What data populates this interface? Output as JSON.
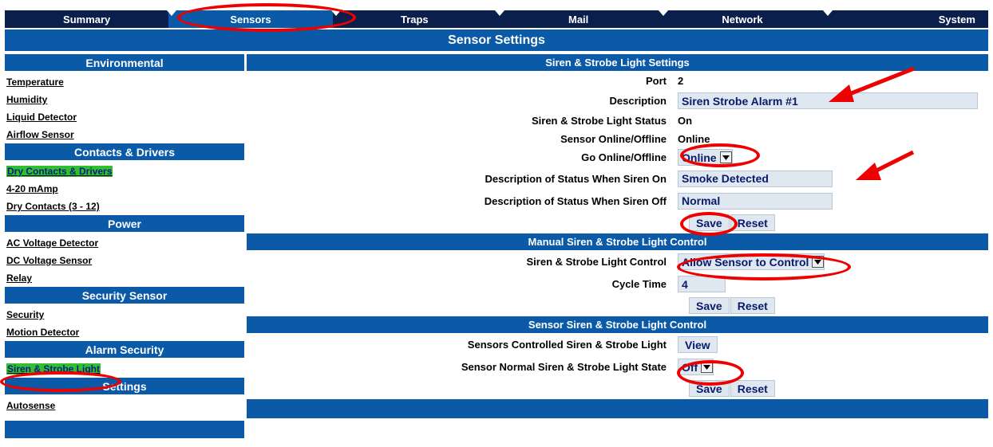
{
  "tabs": [
    "Summary",
    "Sensors",
    "Traps",
    "Mail",
    "Network",
    "System"
  ],
  "active_tab": "Sensors",
  "page_title": "Sensor Settings",
  "sidebar": {
    "sections": [
      {
        "title": "Environmental",
        "links": [
          "Temperature",
          "Humidity",
          "Liquid Detector",
          "Airflow Sensor"
        ]
      },
      {
        "title": "Contacts & Drivers",
        "links": [
          "Dry Contacts & Drivers",
          "4-20 mAmp",
          "Dry Contacts (3 - 12)"
        ]
      },
      {
        "title": "Power",
        "links": [
          "AC Voltage Detector",
          "DC Voltage Sensor",
          "Relay"
        ]
      },
      {
        "title": "Security Sensor",
        "links": [
          "Security",
          "Motion Detector"
        ]
      },
      {
        "title": "Alarm Security",
        "links": [
          "Siren & Strobe Light"
        ]
      },
      {
        "title": "Settings",
        "links": [
          "Autosense"
        ]
      }
    ]
  },
  "settings": {
    "header": "Siren & Strobe Light Settings",
    "port_label": "Port",
    "port_value": "2",
    "description_label": "Description",
    "description_value": "Siren Strobe Alarm #1",
    "status_label": "Siren & Strobe Light Status",
    "status_value": "On",
    "online_label": "Sensor Online/Offline",
    "online_value": "Online",
    "go_online_label": "Go Online/Offline",
    "go_online_value": "Online",
    "desc_on_label": "Description of Status When Siren On",
    "desc_on_value": "Smoke Detected",
    "desc_off_label": "Description of Status When Siren Off",
    "desc_off_value": "Normal",
    "save": "Save",
    "reset": "Reset"
  },
  "manual": {
    "header": "Manual Siren & Strobe Light Control",
    "control_label": "Siren & Strobe Light Control",
    "control_value": "Allow Sensor to Control",
    "cycle_label": "Cycle Time",
    "cycle_value": "4",
    "save": "Save",
    "reset": "Reset"
  },
  "sensor_control": {
    "header": "Sensor Siren & Strobe Light Control",
    "controlled_label": "Sensors Controlled Siren & Strobe Light",
    "view": "View",
    "normal_state_label": "Sensor Normal Siren & Strobe Light State",
    "normal_state_value": "Off",
    "save": "Save",
    "reset": "Reset"
  },
  "colors": {
    "nav": "#0b1f4d",
    "accent": "#0a5aa8",
    "active_link": "#2fbf2f",
    "annotation": "#e00000"
  }
}
